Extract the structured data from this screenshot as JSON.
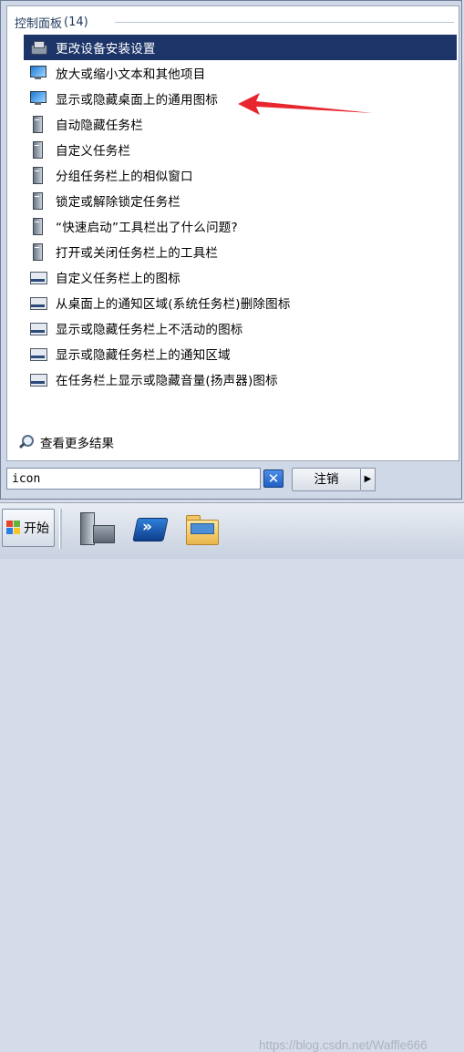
{
  "results": {
    "group_title": "控制面板",
    "group_count": "(14)",
    "items": [
      {
        "label": "更改设备安装设置",
        "icon": "device-settings-icon",
        "selected": true
      },
      {
        "label": "放大或缩小文本和其他项目",
        "icon": "monitor-icon"
      },
      {
        "label": "显示或隐藏桌面上的通用图标",
        "icon": "monitor-icon"
      },
      {
        "label": "自动隐藏任务栏",
        "icon": "taskbar-properties-icon"
      },
      {
        "label": "自定义任务栏",
        "icon": "taskbar-properties-icon"
      },
      {
        "label": "分组任务栏上的相似窗口",
        "icon": "taskbar-properties-icon"
      },
      {
        "label": "锁定或解除锁定任务栏",
        "icon": "taskbar-properties-icon"
      },
      {
        "label": "“快速启动”工具栏出了什么问题?",
        "icon": "taskbar-properties-icon"
      },
      {
        "label": "打开或关闭任务栏上的工具栏",
        "icon": "taskbar-properties-icon"
      },
      {
        "label": "自定义任务栏上的图标",
        "icon": "notification-area-icon"
      },
      {
        "label": "从桌面上的通知区域(系统任务栏)删除图标",
        "icon": "notification-area-icon"
      },
      {
        "label": "显示或隐藏任务栏上不活动的图标",
        "icon": "notification-area-icon"
      },
      {
        "label": "显示或隐藏任务栏上的通知区域",
        "icon": "notification-area-icon"
      },
      {
        "label": "在任务栏上显示或隐藏音量(扬声器)图标",
        "icon": "notification-area-icon"
      }
    ],
    "see_more": "查看更多结果"
  },
  "search": {
    "value": "icon",
    "clear_symbol": "✕",
    "logoff_label": "注销",
    "power_arrow": "▶"
  },
  "taskbar": {
    "start_label": "开始",
    "pinned": [
      "server-manager-icon",
      "powershell-icon",
      "explorer-folder-icon"
    ]
  },
  "watermark": "https://blog.csdn.net/Waffle666",
  "colors": {
    "selection": "#1c3468",
    "annotation_arrow": "#e8262f"
  }
}
